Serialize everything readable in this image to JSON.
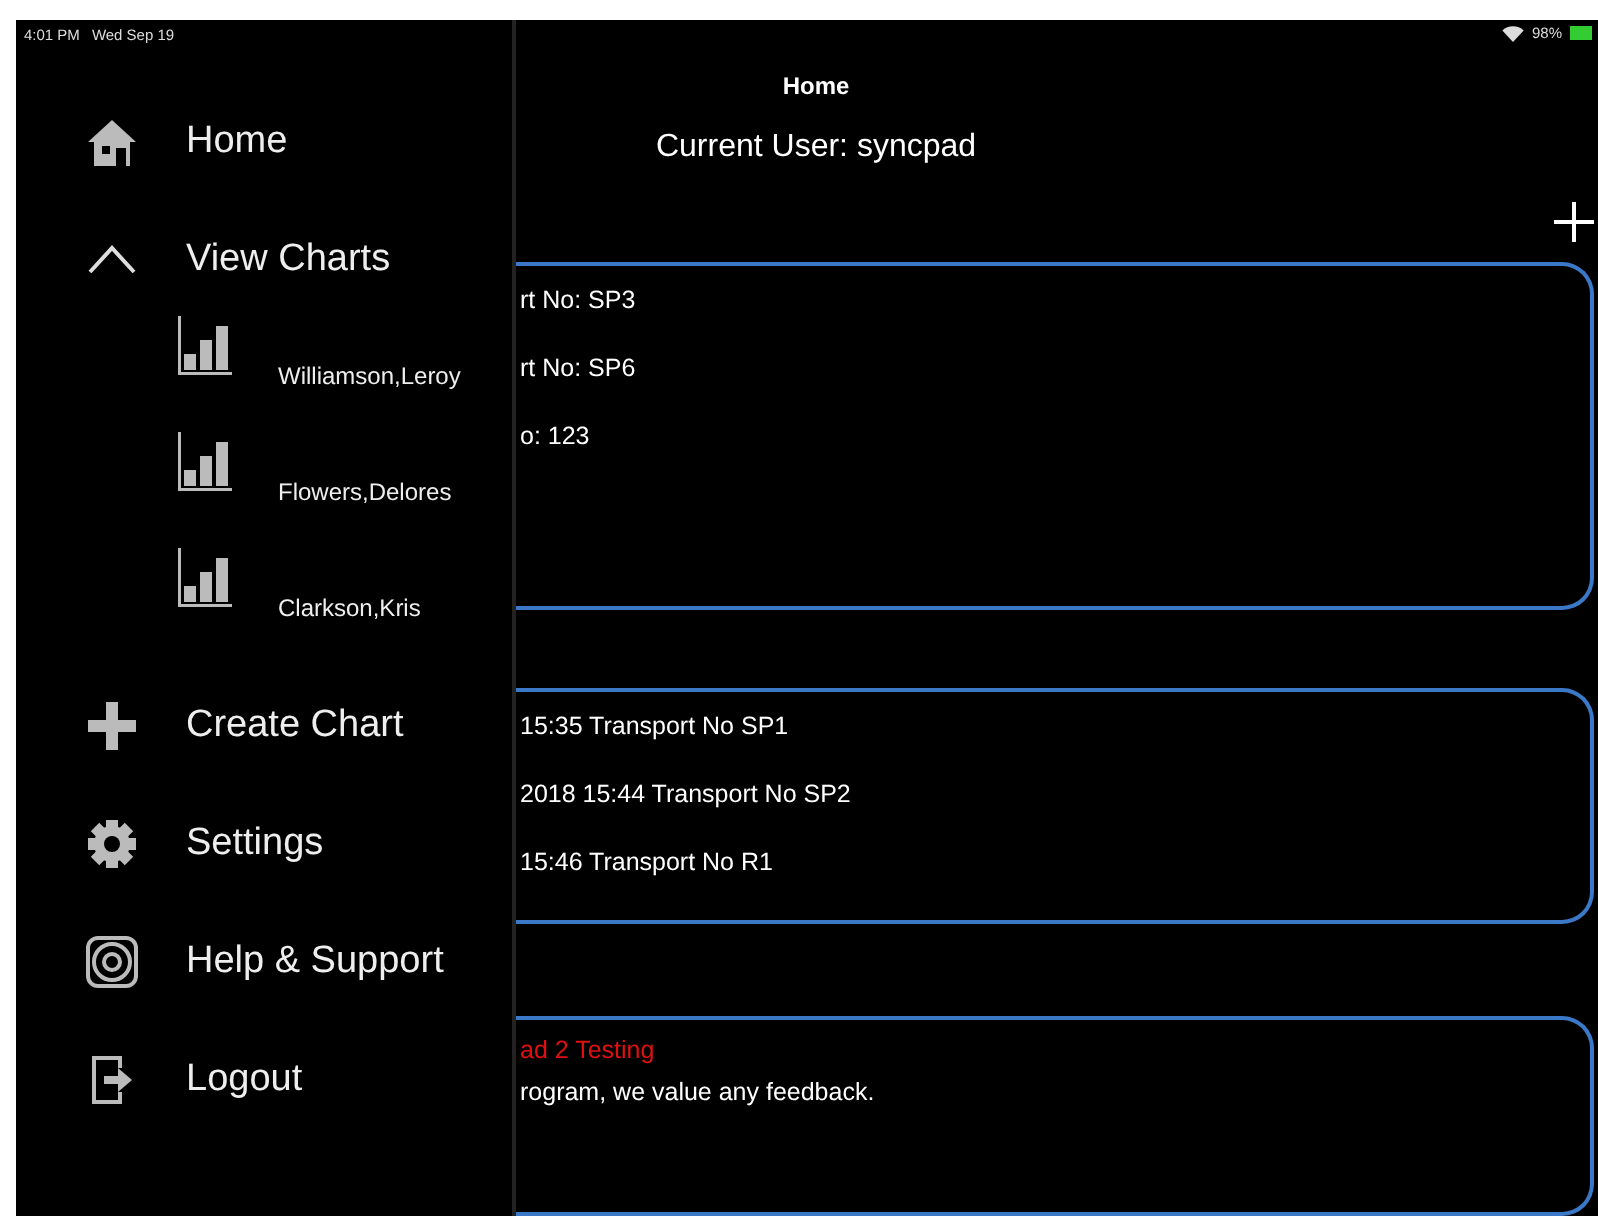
{
  "status_bar": {
    "time": "4:01 PM",
    "date": "Wed Sep 19",
    "battery": "98%"
  },
  "sidebar": {
    "items": [
      {
        "label": "Home"
      },
      {
        "label": "View Charts",
        "expanded": true,
        "children": [
          {
            "label": "Williamson,Leroy"
          },
          {
            "label": "Flowers,Delores"
          },
          {
            "label": "Clarkson,Kris"
          }
        ]
      },
      {
        "label": "Create Chart"
      },
      {
        "label": "Settings"
      },
      {
        "label": "Help & Support"
      },
      {
        "label": "Logout"
      }
    ]
  },
  "header": {
    "title": "Home",
    "subtitle": "Current User: syncpad"
  },
  "cards": [
    {
      "kind": "list",
      "lines": [
        "rt No: SP3",
        "rt No: SP6",
        "o: 123"
      ]
    },
    {
      "kind": "list",
      "lines": [
        "15:35 Transport No SP1",
        "2018 15:44 Transport No SP2",
        "15:46 Transport No R1"
      ]
    },
    {
      "kind": "message",
      "lines": [
        "ad 2 Testing",
        "rogram, we value any feedback."
      ]
    }
  ]
}
